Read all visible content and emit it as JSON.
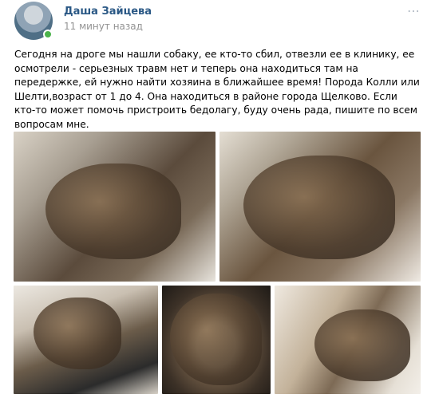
{
  "post": {
    "author": "Даша Зайцева",
    "time": "11 минут назад",
    "more_icon": "⋯",
    "text": "Сегодня на дроге мы нашли собаку, ее кто-то сбил, отвезли ее в клинику, ее осмотрели - серьезных травм нет и теперь она находиться там на передержке, ей нужно найти хозяина в ближайшее время! Порода Колли или Шелти,возраст от 1 до 4. Она находиться в районе города Щелково. Если кто-то может помочь пристроить бедолагу, буду очень рада, пишите по всем вопросам мне."
  },
  "colors": {
    "author_link": "#2a5885",
    "time": "#939393",
    "online": "#4bb34b"
  }
}
